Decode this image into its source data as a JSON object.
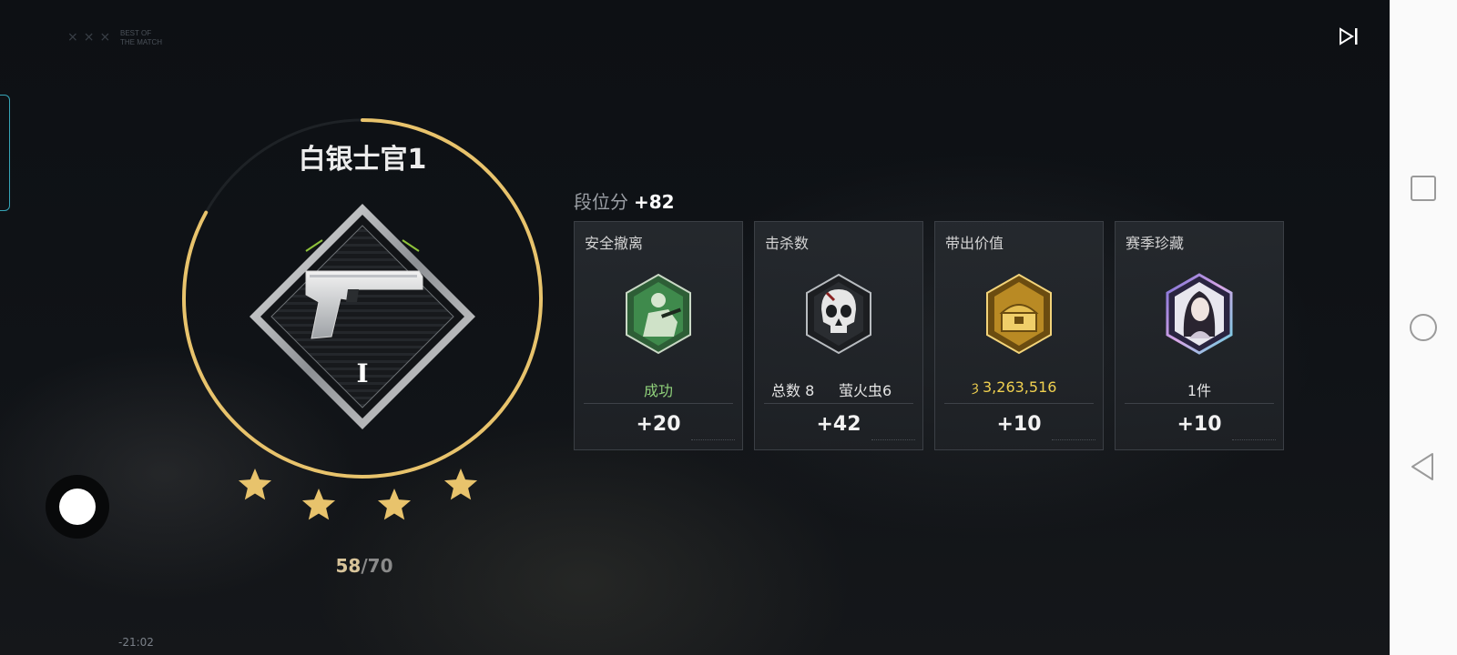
{
  "header": {
    "logo_line1": "BEST OF",
    "logo_line2": "THE MATCH"
  },
  "rank": {
    "title": "白银士官1",
    "tier_numeral": "I",
    "stars_earned": 4,
    "score_current": "58",
    "score_separator": "/",
    "score_max": "70",
    "progress_fraction": 0.83
  },
  "points": {
    "label": "段位分",
    "value": "+82"
  },
  "cards": [
    {
      "title": "安全撤离",
      "icon": "soldier-badge-icon",
      "value": "成功",
      "value_color": "#8fd07a",
      "score": "+20"
    },
    {
      "title": "击杀数",
      "icon": "skull-badge-icon",
      "value_left": "总数 8",
      "value_right": "萤火虫6",
      "score": "+42"
    },
    {
      "title": "带出价值",
      "icon": "treasure-badge-icon",
      "value": "3,263,516",
      "value_color": "#f0d050",
      "currency_icon": "coin-icon",
      "score": "+10"
    },
    {
      "title": "赛季珍藏",
      "icon": "portrait-badge-icon",
      "value": "1件",
      "score": "+10"
    }
  ],
  "footer": {
    "time": "-21:02"
  },
  "colors": {
    "accent_gold": "#e8c36c",
    "success_green": "#8fd07a",
    "value_gold": "#f0d050",
    "edge_tab": "#36a4b6"
  },
  "icons": {
    "skip": "skip-forward-icon",
    "nav_recent": "square-recent-apps-icon",
    "nav_home": "circle-home-icon",
    "nav_back": "triangle-back-icon"
  }
}
